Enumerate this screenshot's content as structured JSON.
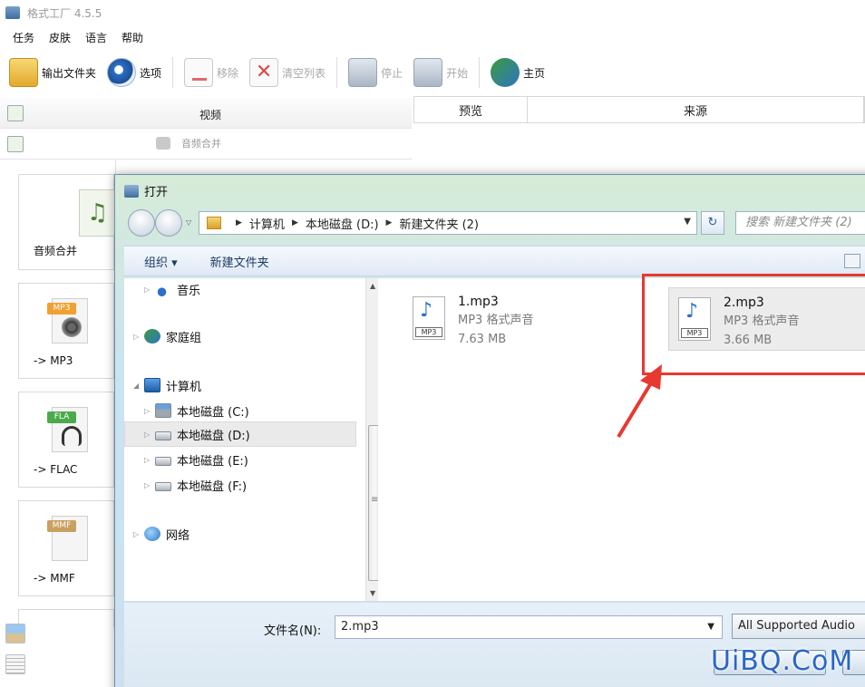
{
  "app": {
    "title": "格式工厂 4.5.5",
    "menu": [
      "任务",
      "皮肤",
      "语言",
      "帮助"
    ],
    "toolbar": {
      "output_folder": "输出文件夹",
      "options": "选项",
      "remove": "移除",
      "clear_list": "清空列表",
      "stop": "停止",
      "start": "开始",
      "home": "主页"
    },
    "categories": {
      "video": "视频",
      "audio_merge": "音频合并"
    },
    "list_headers": {
      "preview": "预览",
      "source": "来源"
    },
    "format_cards": [
      "音频合并",
      "-> MP3",
      "-> FLAC",
      "-> MMF"
    ],
    "format_tags": [
      "MP3",
      "FLA",
      "MMF"
    ]
  },
  "dialog": {
    "title": "打开",
    "breadcrumb": [
      "计算机",
      "本地磁盘 (D:)",
      "新建文件夹 (2)"
    ],
    "search_placeholder": "搜索 新建文件夹 (2)",
    "organize": "组织 ▾",
    "new_folder": "新建文件夹",
    "nav": {
      "music": "音乐",
      "homegroup": "家庭组",
      "computer": "计算机",
      "disk_c": "本地磁盘 (C:)",
      "disk_d": "本地磁盘 (D:)",
      "disk_e": "本地磁盘 (E:)",
      "disk_f": "本地磁盘 (F:)",
      "network": "网络"
    },
    "files": [
      {
        "name": "1.mp3",
        "type": "MP3 格式声音",
        "size": "7.63 MB",
        "tag": "MP3"
      },
      {
        "name": "2.mp3",
        "type": "MP3 格式声音",
        "size": "3.66 MB",
        "tag": "MP3"
      }
    ],
    "filename_label": "文件名(N):",
    "filename_value": "2.mp3",
    "file_type": "All Supported Audio"
  },
  "watermark": "UiBQ.CoM",
  "colors": {
    "highlight_red": "#e8382f",
    "watermark_blue": "#2a66c9"
  }
}
